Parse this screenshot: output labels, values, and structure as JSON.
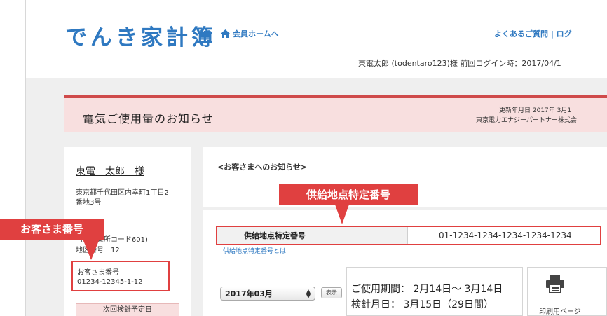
{
  "header": {
    "logo": "でんき家計簿",
    "home_link": "会員ホームへ",
    "top_links": "よくあるご質問 | ログ",
    "user_line": "東電太郎 (todentaro123)様 前回ログイン時：2017/04/1"
  },
  "notice": {
    "title": "電気ご使用量のお知らせ",
    "updated": "更新年月日 2017年 3月1",
    "company": "東京電力エナジーパートナー株式会"
  },
  "customer": {
    "name": "東電　太郎　様",
    "address_line1": "東京都千代田区内幸町1丁目2",
    "address_line2": "番地3号",
    "contract_line": "社(事業所コード601)",
    "site_line": "地区番号　12",
    "number_label": "お客さま番号",
    "number_value": "01234-12345-1-12",
    "next_meter": "次回検針予定日"
  },
  "main": {
    "notice_heading": "<お客さまへのお知らせ>",
    "supply_label": "供給地点特定番号",
    "supply_value": "01-1234-1234-1234-1234-1234",
    "supply_link": "供給地点特定番号とは",
    "month_selected": "2017年03月",
    "show_button": "表示",
    "period_line": "ご使用期間： 2月14日〜 3月14日",
    "meter_line": "検針月日： 3月15日（29日間）",
    "print_label": "印刷用ページ"
  },
  "callouts": {
    "supply": "供給地点特定番号",
    "customer": "お客さま番号"
  },
  "colors": {
    "brand_blue": "#2f79c1",
    "highlight_red": "#e04040",
    "notice_pink": "#f8dfdf",
    "background_gray": "#efefef"
  }
}
